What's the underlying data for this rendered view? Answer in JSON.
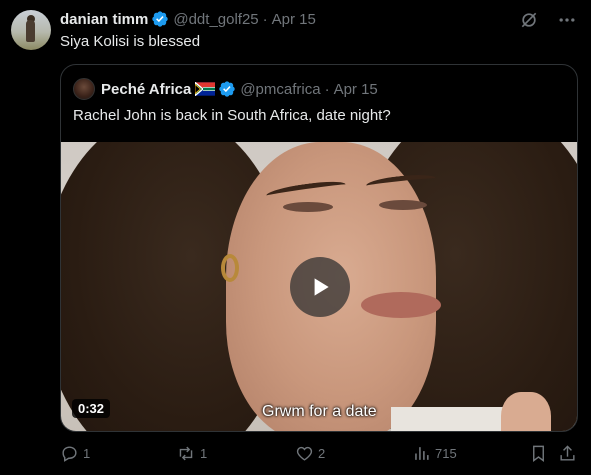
{
  "tweet": {
    "author_name": "danian timm",
    "handle": "@ddt_golf25",
    "separator": "·",
    "date": "Apr 15",
    "text": "Siya Kolisi is blessed"
  },
  "quoted": {
    "author_name": "Peché Africa",
    "handle": "@pmcafrica",
    "separator": "·",
    "date": "Apr 15",
    "text": "Rachel John is back in South Africa, date night?",
    "video": {
      "duration": "0:32",
      "caption": "Grwm for a date"
    }
  },
  "actions": {
    "replies": "1",
    "reposts": "1",
    "likes": "2",
    "views": "715"
  },
  "colors": {
    "background": "#000000",
    "text": "#e7e9ea",
    "muted": "#71767b",
    "verified": "#1d9bf0",
    "border": "#2f3336"
  },
  "icons": [
    "verified-badge-icon",
    "grok-icon",
    "more-icon",
    "reply-icon",
    "repost-icon",
    "like-icon",
    "views-icon",
    "bookmark-icon",
    "share-icon",
    "play-icon",
    "south-africa-flag-icon"
  ]
}
